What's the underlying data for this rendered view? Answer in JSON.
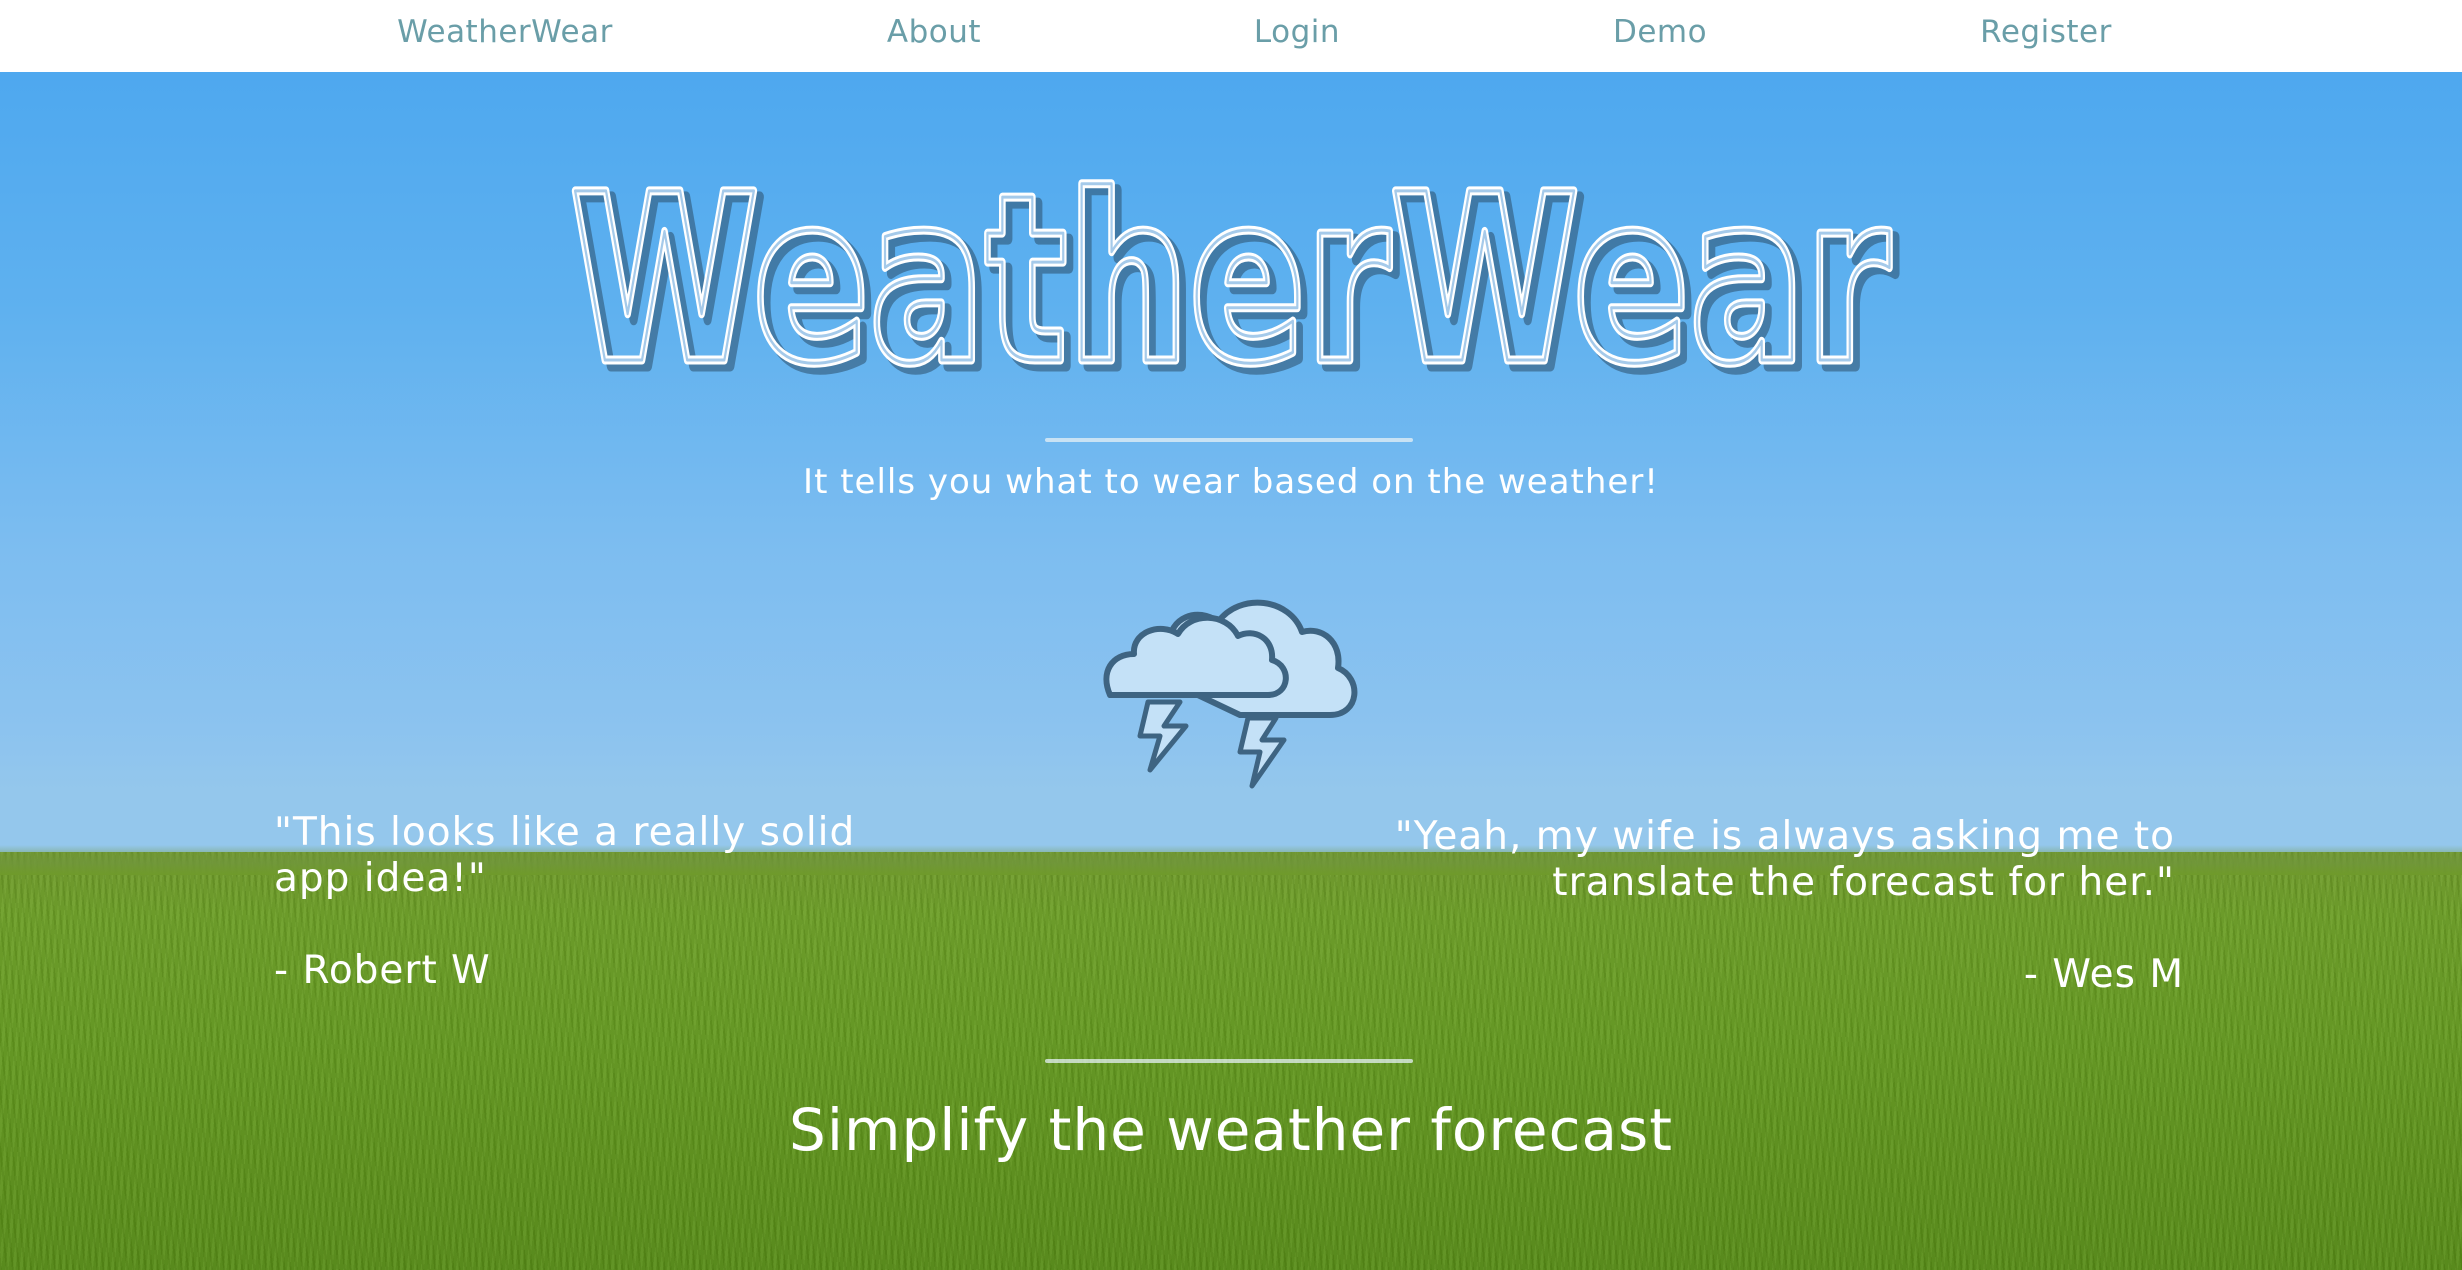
{
  "nav": {
    "items": [
      {
        "label": "WeatherWear"
      },
      {
        "label": "About"
      },
      {
        "label": "Login"
      },
      {
        "label": "Demo"
      },
      {
        "label": "Register"
      }
    ]
  },
  "hero": {
    "title": "WeatherWear",
    "tagline": "It tells you what to wear based on the weather!",
    "icon": "thunderstorm-cloud-icon"
  },
  "testimonials": [
    {
      "quote": "\"This looks like a really solid app idea!\"",
      "author": "- Robert W"
    },
    {
      "quote": "\"Yeah, my wife is always asking me to translate the forecast for her.\"",
      "author": "- Wes M"
    }
  ],
  "footer": {
    "heading": "Simplify the weather forecast"
  },
  "colors": {
    "nav_link": "#6a9ea8",
    "sky_top": "#4ea8ef",
    "sky_bottom": "#94c7ec",
    "grass": "#649a1f",
    "icon_fill": "#c4e1f7",
    "icon_stroke": "#3e6482"
  }
}
